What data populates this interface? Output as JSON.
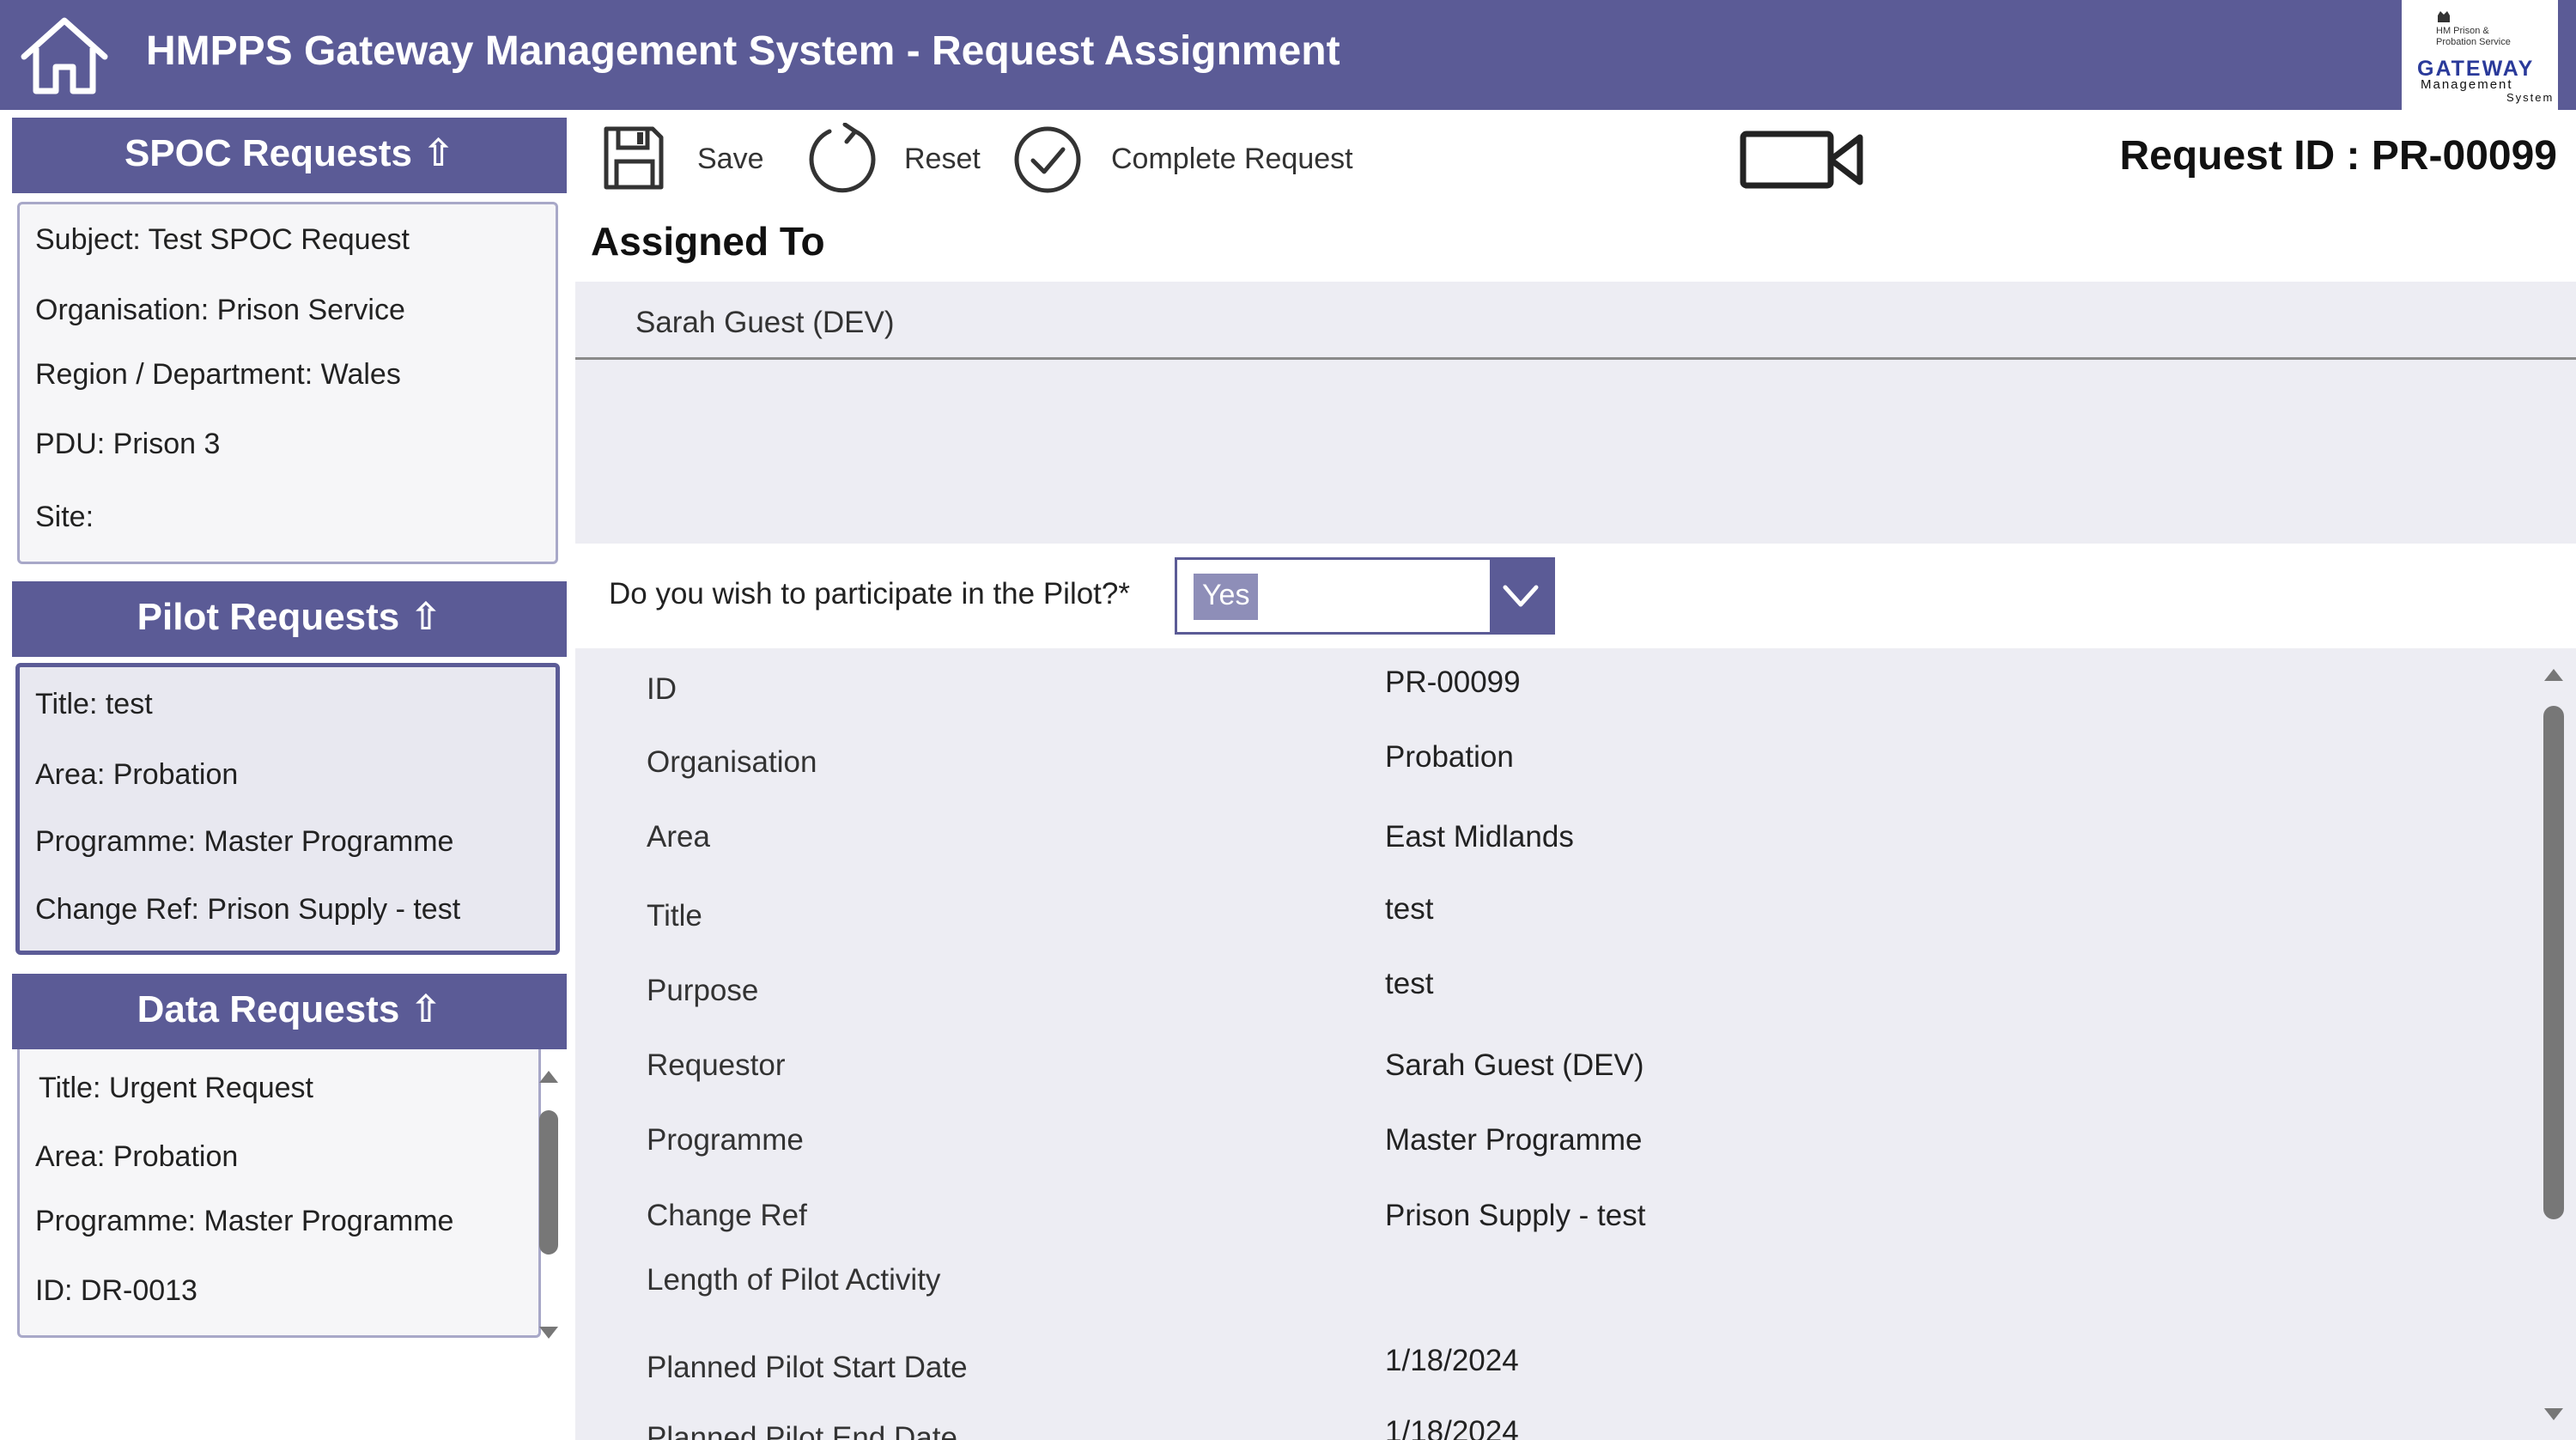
{
  "header": {
    "title": "HMPPS Gateway Management System - Request Assignment",
    "home_icon": "home-icon",
    "logo": {
      "org_line1": "HM Prison &",
      "org_line2": "Probation Service",
      "main": "GATEWAY",
      "sub1": "Management",
      "sub2": "System"
    }
  },
  "colors": {
    "brand": "#5b5b96",
    "panel_bg": "#ededf3",
    "dropdown_value_bg": "#8e8eb8"
  },
  "toolbar": {
    "save_label": "Save",
    "reset_label": "Reset",
    "complete_label": "Complete Request",
    "request_id": "Request ID : PR-00099"
  },
  "sidebar": {
    "spoc": {
      "title": "SPOC Requests ⇧",
      "lines": [
        "Subject: Test SPOC Request",
        "Organisation: Prison Service",
        "Region / Department: Wales",
        "PDU: Prison 3",
        "Site:"
      ]
    },
    "pilot": {
      "title": "Pilot Requests ⇧",
      "lines": [
        "Title: test",
        "Area: Probation",
        "Programme: Master Programme",
        "Change Ref: Prison Supply - test"
      ]
    },
    "data": {
      "title": "Data Requests ⇧",
      "lines": [
        "Title: Urgent Request",
        "Area: Probation",
        "Programme: Master Programme",
        "ID: DR-0013"
      ]
    }
  },
  "assignment": {
    "section_title": "Assigned To",
    "assignee": "Sarah Guest (DEV)"
  },
  "pilot_question": {
    "label": "Do you wish to participate in the Pilot?*",
    "selected": "Yes"
  },
  "details": [
    {
      "label": "ID",
      "value": "PR-00099"
    },
    {
      "label": "Organisation",
      "value": "Probation"
    },
    {
      "label": "Area",
      "value": "East Midlands"
    },
    {
      "label": "Title",
      "value": "test"
    },
    {
      "label": "Purpose",
      "value": "test"
    },
    {
      "label": "Requestor",
      "value": "Sarah Guest (DEV)"
    },
    {
      "label": "Programme",
      "value": "Master Programme"
    },
    {
      "label": "Change Ref",
      "value": "Prison Supply - test"
    },
    {
      "label": "Length of Pilot Activity",
      "value": ""
    },
    {
      "label": "Planned Pilot Start Date",
      "value": "1/18/2024"
    },
    {
      "label": "Planned Pilot End Date",
      "value": "1/18/2024"
    }
  ]
}
